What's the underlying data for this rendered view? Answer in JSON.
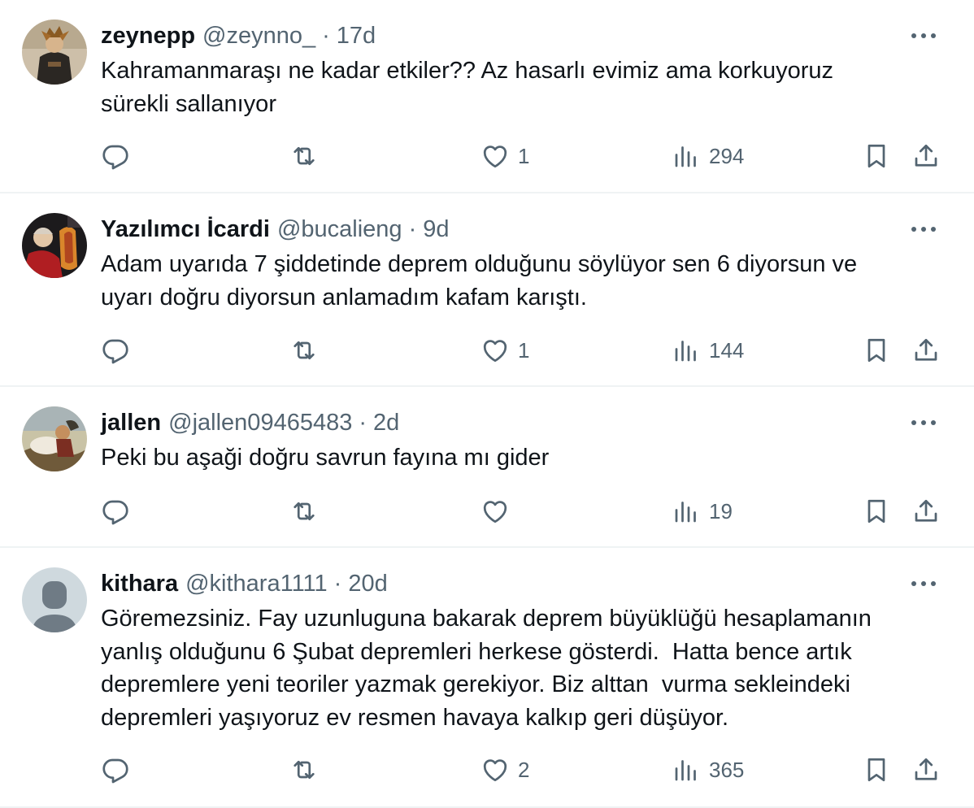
{
  "tweets": [
    {
      "name": "zeynepp",
      "handle": "@zeynno_",
      "separator": "·",
      "time": "17d",
      "text": "Kahramanmaraşı ne kadar etkiler?? Az hasarlı evimiz ama korkuyoruz\nsürekli sallanıyor",
      "likes": "1",
      "views": "294",
      "avatar_icon": "user-photo-avatar"
    },
    {
      "name": "Yazılımcı İcardi",
      "handle": "@bucalieng",
      "separator": "·",
      "time": "9d",
      "text": "Adam uyarıda 7 şiddetinde deprem olduğunu söylüyor sen 6 diyorsun ve\nuyarı doğru diyorsun anlamadım kafam karıştı.",
      "likes": "1",
      "views": "144",
      "avatar_icon": "user-photo-avatar"
    },
    {
      "name": "jallen",
      "handle": "@jallen09465483",
      "separator": "·",
      "time": "2d",
      "text": "Peki bu aşaği doğru savrun fayına mı gider",
      "likes": "",
      "views": "19",
      "avatar_icon": "painting-avatar"
    },
    {
      "name": "kithara",
      "handle": "@kithara1111",
      "separator": "·",
      "time": "20d",
      "text": "Göremezsiniz. Fay uzunluguna bakarak deprem büyüklüğü hesaplamanın\nyanlış olduğunu 6 Şubat depremleri herkese gösterdi.  Hatta bence artık\ndepremlere yeni teoriler yazmak gerekiyor. Biz alttan  vurma sekleindeki\ndepremleri yaşıyoruz ev resmen havaya kalkıp geri düşüyor.",
      "likes": "2",
      "views": "365",
      "avatar_icon": "default-user-avatar"
    }
  ],
  "colors": {
    "text_primary": "#0f1419",
    "text_secondary": "#536471",
    "divider": "#eff3f4"
  },
  "icons": {
    "reply": "reply-icon",
    "retweet": "retweet-icon",
    "like": "heart-icon",
    "views": "views-icon",
    "bookmark": "bookmark-icon",
    "share": "share-icon",
    "more": "more-icon"
  }
}
